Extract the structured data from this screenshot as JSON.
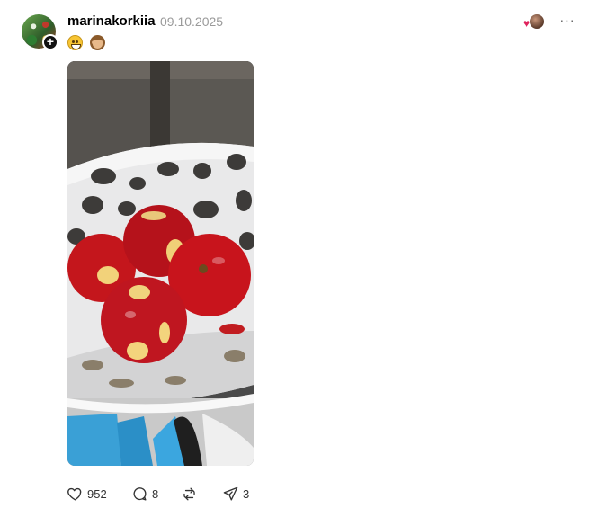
{
  "post": {
    "username": "marinakorkiia",
    "date": "09.10.2025",
    "caption_emojis": [
      "grinning-face-emoji",
      "see-no-evil-monkey-emoji"
    ],
    "image_alt_subject": "red apples with bites in a white ceramic bowl"
  },
  "header_right": {
    "reactions_icons": [
      "heart-icon",
      "reactor-avatar"
    ],
    "more_icon": "more-dots-icon",
    "more_label": "···"
  },
  "actions": {
    "likes": "952",
    "replies": "8",
    "shares": "3"
  },
  "colors": {
    "heart": "#e0245e",
    "date_gray": "#9a9a9a",
    "apple_red": "#c4161c"
  }
}
